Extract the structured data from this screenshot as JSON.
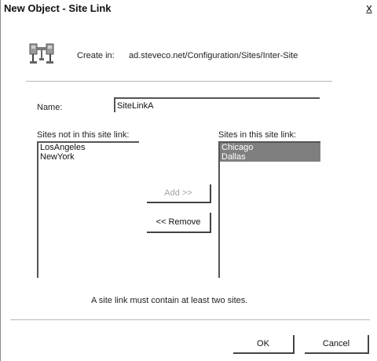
{
  "window": {
    "title": "New Object - Site Link",
    "close_label": "x"
  },
  "header": {
    "icon": "site-link-icon",
    "create_in_label": "Create in:",
    "create_in_path": "ad.steveco.net/Configuration/Sites/Inter-Site"
  },
  "form": {
    "name_label": "Name:",
    "name_value": "SiteLinkA"
  },
  "lists": {
    "available_label": "Sites not in this site link:",
    "available_items": [
      "LosAngeles",
      "NewYork"
    ],
    "selected_label": "Sites in this site link:",
    "selected_items": [
      "Chicago",
      "Dallas"
    ]
  },
  "buttons": {
    "add_label": "Add >>",
    "remove_label": "<< Remove",
    "ok_label": "OK",
    "cancel_label": "Cancel"
  },
  "hint_text": "A site link must contain at least two sites.",
  "colors": {
    "selection": "#7f7f7f",
    "disabled_text": "#a3a3a3",
    "separator": "#b8b8b8"
  }
}
